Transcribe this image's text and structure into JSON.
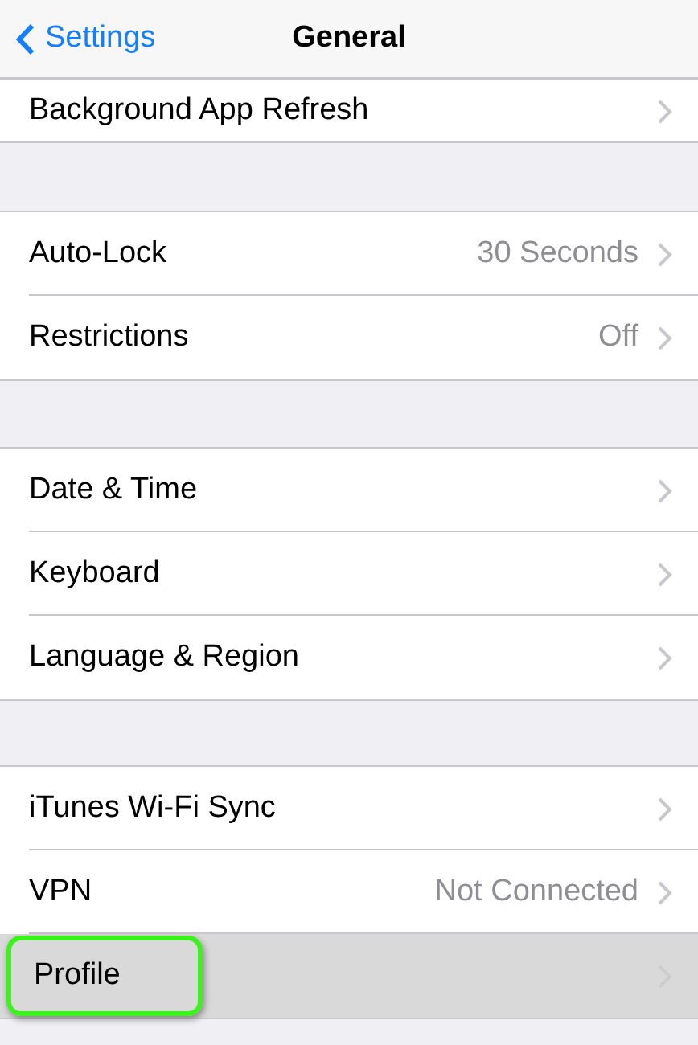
{
  "nav_bar": {
    "back_label": "Settings",
    "title": "General"
  },
  "sections": [
    {
      "rows": [
        {
          "label": "Background App Refresh",
          "selected": false,
          "highlighted": false
        }
      ]
    },
    {
      "rows": [
        {
          "label": "Auto-Lock",
          "value": "30 Seconds",
          "selected": false,
          "highlighted": false
        },
        {
          "label": "Restrictions",
          "value": "Off",
          "selected": false,
          "highlighted": false
        }
      ]
    },
    {
      "rows": [
        {
          "label": "Date & Time",
          "selected": false,
          "highlighted": false
        },
        {
          "label": "Keyboard",
          "selected": false,
          "highlighted": false
        },
        {
          "label": "Language & Region",
          "selected": false,
          "highlighted": false
        }
      ]
    },
    {
      "rows": [
        {
          "label": "iTunes Wi-Fi Sync",
          "selected": false,
          "highlighted": false
        },
        {
          "label": "VPN",
          "value": "Not Connected",
          "selected": false,
          "highlighted": false
        },
        {
          "label": "Profile",
          "selected": true,
          "highlighted": true
        }
      ]
    }
  ]
}
